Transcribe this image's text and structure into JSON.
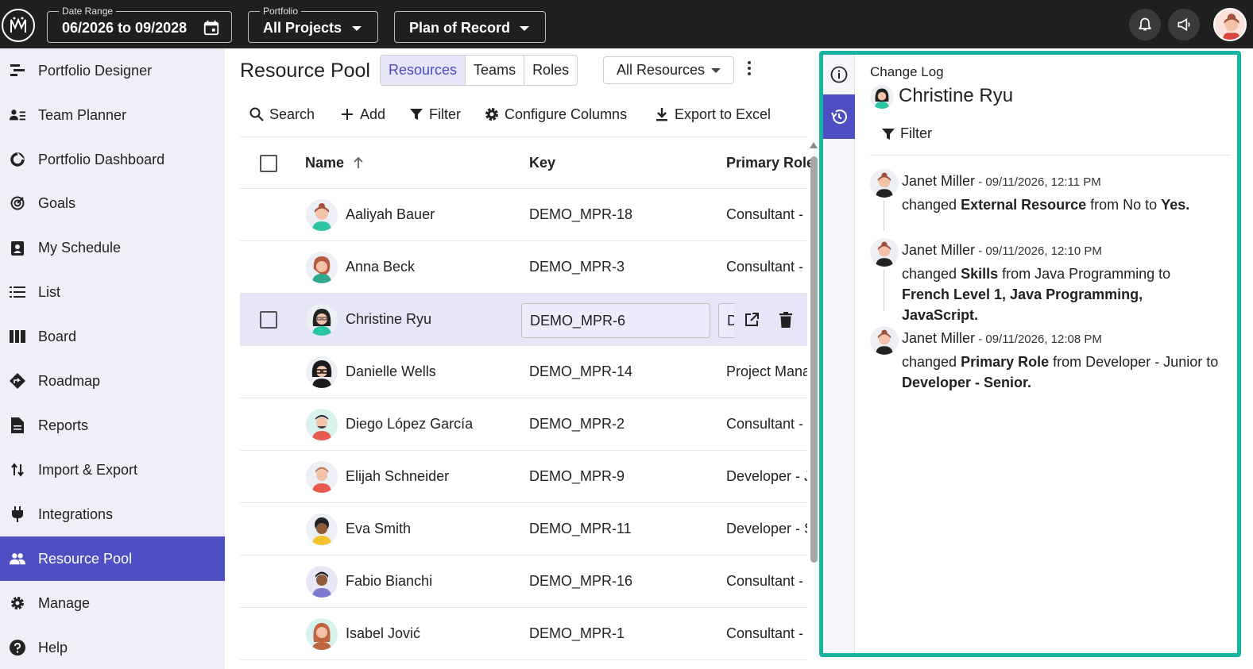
{
  "topbar": {
    "date_range": {
      "label": "Date Range",
      "value": "06/2026 to 09/2028"
    },
    "portfolio": {
      "label": "Portfolio",
      "value": "All Projects"
    },
    "plan": {
      "value": "Plan of Record"
    }
  },
  "sidebar": {
    "items": [
      {
        "label": "Portfolio Designer",
        "icon": "portfolio-designer-icon"
      },
      {
        "label": "Team Planner",
        "icon": "team-planner-icon"
      },
      {
        "label": "Portfolio Dashboard",
        "icon": "dashboard-icon"
      },
      {
        "label": "Goals",
        "icon": "goals-icon"
      },
      {
        "label": "My Schedule",
        "icon": "schedule-icon"
      },
      {
        "label": "List",
        "icon": "list-icon"
      },
      {
        "label": "Board",
        "icon": "board-icon"
      },
      {
        "label": "Roadmap",
        "icon": "roadmap-icon"
      },
      {
        "label": "Reports",
        "icon": "reports-icon"
      },
      {
        "label": "Import & Export",
        "icon": "import-export-icon"
      },
      {
        "label": "Integrations",
        "icon": "plug-icon"
      },
      {
        "label": "Resource Pool",
        "icon": "people-icon",
        "active": true
      },
      {
        "label": "Manage",
        "icon": "gear-icon"
      },
      {
        "label": "Help",
        "icon": "help-icon"
      }
    ],
    "active_color": "#4f4fc4"
  },
  "main": {
    "title": "Resource Pool",
    "tabs": [
      {
        "label": "Resources",
        "active": true
      },
      {
        "label": "Teams"
      },
      {
        "label": "Roles"
      }
    ],
    "filter_select": "All Resources",
    "toolbar": {
      "search": "Search",
      "add": "Add",
      "filter": "Filter",
      "configure": "Configure Columns",
      "export": "Export to Excel"
    },
    "table": {
      "columns": {
        "name": "Name",
        "key": "Key",
        "role": "Primary Role"
      },
      "rows": [
        {
          "name": "Aaliyah Bauer",
          "key": "DEMO_MPR-18",
          "role": "Consultant -"
        },
        {
          "name": "Anna Beck",
          "key": "DEMO_MPR-3",
          "role": "Consultant -"
        },
        {
          "name": "Christine Ryu",
          "key": "DEMO_MPR-6",
          "role": "D",
          "selected": true
        },
        {
          "name": "Danielle Wells",
          "key": "DEMO_MPR-14",
          "role": "Project Mana"
        },
        {
          "name": "Diego López García",
          "key": "DEMO_MPR-2",
          "role": "Consultant -"
        },
        {
          "name": "Elijah Schneider",
          "key": "DEMO_MPR-9",
          "role": "Developer - J"
        },
        {
          "name": "Eva Smith",
          "key": "DEMO_MPR-11",
          "role": "Developer - S"
        },
        {
          "name": "Fabio Bianchi",
          "key": "DEMO_MPR-16",
          "role": "Consultant -"
        },
        {
          "name": "Isabel Jović",
          "key": "DEMO_MPR-1",
          "role": "Consultant -"
        }
      ]
    }
  },
  "panel": {
    "header": "Change Log",
    "name": "Christine Ryu",
    "filter": "Filter",
    "accent": "#19b3a2",
    "entries": [
      {
        "user": "Janet Miller",
        "sep": " - ",
        "date": "09/11/2026, 12:11 PM",
        "t1": "changed ",
        "field": "External Resource",
        "t2": " from No to ",
        "to": "Yes."
      },
      {
        "user": "Janet Miller",
        "sep": " - ",
        "date": "09/11/2026, 12:10 PM",
        "t1": "changed ",
        "field": "Skills",
        "t2": " from Java Programming to ",
        "to": "French Level 1, Java Programming, JavaScript."
      },
      {
        "user": "Janet Miller",
        "sep": " - ",
        "date": "09/11/2026, 12:08 PM",
        "t1": "changed ",
        "field": "Primary Role",
        "t2": " from Developer - Junior to ",
        "to": "Developer - Senior."
      }
    ]
  }
}
